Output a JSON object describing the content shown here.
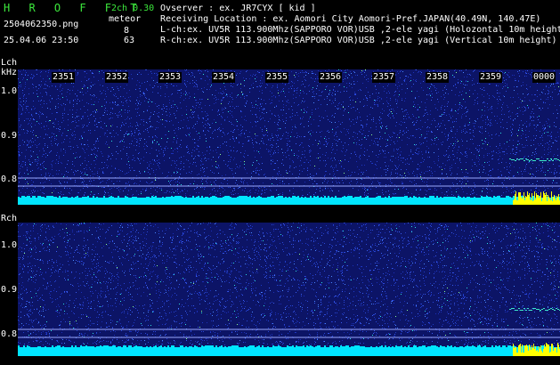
{
  "header": {
    "logo": "H R O F F T",
    "version": "2ch 0.30",
    "mode": "meteor",
    "filename": "2504062350.png",
    "datetime": "25.04.06 23:50",
    "count_l": "8",
    "count_r": "63",
    "observer_line": "Ovserver            : ex. JR7CYX [ kid ]",
    "location_line": "Receiving Location : ex. Aomori City Aomori-Pref.JAPAN(40.49N, 140.47E)",
    "lch_line": "L-ch:ex. UV5R 113.900Mhz(SAPPORO VOR)USB ,2-ele yagi (Holozontal 10m height)",
    "rch_line": "R-ch:ex. UV5R 113.900Mhz(SAPPORO VOR)USB ,2-ele yagi (Vertical 10m height)"
  },
  "lch": {
    "label": "Lch",
    "unit": "kHz",
    "ticks": [
      "1.0",
      "0.9",
      "0.8"
    ]
  },
  "rch": {
    "label": "Rch",
    "ticks": [
      "1.0",
      "0.9",
      "0.8"
    ]
  },
  "time_labels": [
    "2351",
    "2352",
    "2353",
    "2354",
    "2355",
    "2356",
    "2357",
    "2358",
    "2359",
    "0000"
  ],
  "colors": {
    "background": "#000000",
    "noise": "#1a2a9a",
    "baseline": "#00e5ff",
    "signal": "#ffff00",
    "text_accent": "#3ce83c"
  }
}
